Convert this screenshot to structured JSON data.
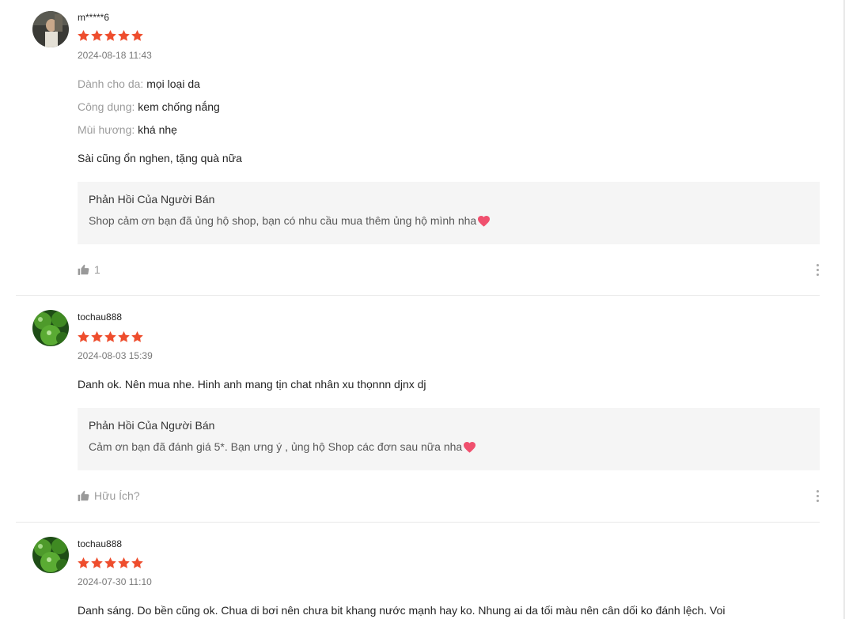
{
  "reviews": [
    {
      "username": "m*****6",
      "rating": 5,
      "date": "2024-08-18 11:43",
      "attributes": [
        {
          "key": "Dành cho da:",
          "value": "mọi loại da"
        },
        {
          "key": "Công dụng:",
          "value": "kem chống nắng"
        },
        {
          "key": "Mùi hương:",
          "value": "khá nhẹ"
        }
      ],
      "content": "Sài cũng ổn nghen, tặng quà nữa",
      "reply_title": "Phản Hồi Của Người Bán",
      "reply_body": "Shop cảm ơn bạn đã ủng hộ shop, bạn có nhu cầu mua thêm ủng hộ mình nha",
      "like_label": "1"
    },
    {
      "username": "tochau888",
      "rating": 5,
      "date": "2024-08-03 15:39",
      "content": "Danh ok. Nên mua nhe. Hinh anh mang tịn chat nhân xu thọnnn djnx dj",
      "reply_title": "Phản Hồi Của Người Bán",
      "reply_body": "Cảm ơn bạn đã đánh giá 5*. Bạn ưng ý , ủng hộ Shop các đơn sau nữa nha",
      "like_label": "Hữu Ích?"
    },
    {
      "username": "tochau888",
      "rating": 5,
      "date": "2024-07-30 11:10",
      "content": "Danh sáng. Do bền cũng ok. Chua di bơi nên chưa bit khang nước mạnh hay ko. Nhung ai da tối màu nên cân dối ko đánh lệch. Voi"
    }
  ],
  "colors": {
    "star": "#ee4d2d",
    "reply_bg": "#f5f5f5",
    "heart": "#f0506e"
  },
  "icons": {
    "like": "thumbs-up-icon",
    "more": "more-vertical-icon",
    "star": "star-icon",
    "heart": "heart-icon"
  }
}
